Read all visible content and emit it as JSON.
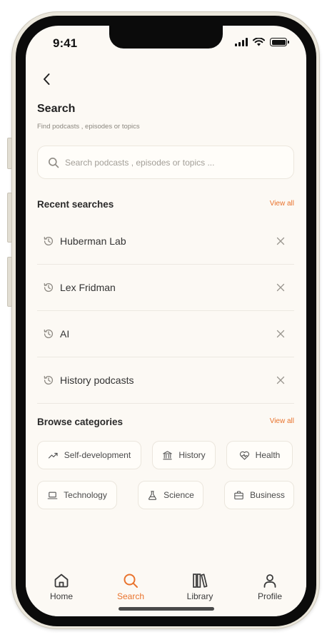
{
  "status_bar": {
    "time": "9:41"
  },
  "header": {
    "title": "Search",
    "subtitle": "Find podcasts , episodes or topics"
  },
  "search": {
    "placeholder": "Search podcasts , episodes or topics ...",
    "value": ""
  },
  "recent": {
    "title": "Recent searches",
    "view_all": "View all",
    "items": [
      {
        "label": "Huberman Lab"
      },
      {
        "label": "Lex Fridman"
      },
      {
        "label": "AI"
      },
      {
        "label": "History podcasts"
      }
    ]
  },
  "categories": {
    "title": "Browse categories",
    "view_all": "View all",
    "items": [
      {
        "label": "Self-development",
        "icon": "trending-up-icon"
      },
      {
        "label": "History",
        "icon": "museum-icon"
      },
      {
        "label": "Health",
        "icon": "heart-pulse-icon"
      },
      {
        "label": "Technology",
        "icon": "laptop-icon"
      },
      {
        "label": "Science",
        "icon": "flask-icon"
      },
      {
        "label": "Business",
        "icon": "briefcase-icon"
      }
    ]
  },
  "tabbar": {
    "items": [
      {
        "label": "Home",
        "icon": "home-icon"
      },
      {
        "label": "Search",
        "icon": "search-icon",
        "active": true
      },
      {
        "label": "Library",
        "icon": "library-icon"
      },
      {
        "label": "Profile",
        "icon": "user-icon"
      }
    ]
  },
  "colors": {
    "accent": "#e9732d",
    "background": "#fcf9f4",
    "text": "#2a2a2a",
    "muted": "#8b877f"
  }
}
